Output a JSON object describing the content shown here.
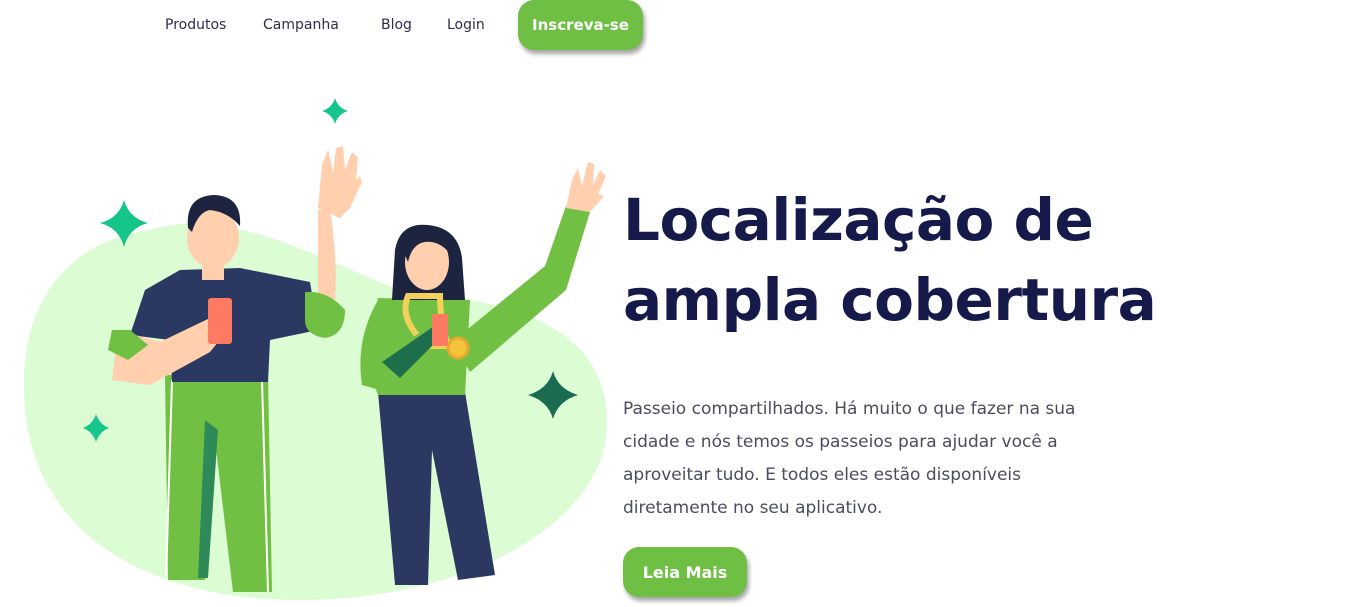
{
  "nav": {
    "items": [
      {
        "label": "Produtos"
      },
      {
        "label": "Campanha"
      },
      {
        "label": "Blog"
      },
      {
        "label": "Login"
      }
    ],
    "signup_label": "Inscreva-se"
  },
  "hero": {
    "title_line1": "Localização de",
    "title_line2": "ampla cobertura",
    "description": "Passeio compartilhados. Há muito o que fazer na sua cidade e nós temos os passeios para ajudar você a aproveitar tudo. E todos eles estão disponíveis diretamente no seu aplicativo.",
    "button_label": "Leia Mais"
  },
  "colors": {
    "accent_green": "#6fbf44",
    "title_navy": "#151a4a",
    "blob_green": "#dcfcd4",
    "sparkle_teal": "#16c58a",
    "sparkle_dark": "#1a6b50"
  }
}
